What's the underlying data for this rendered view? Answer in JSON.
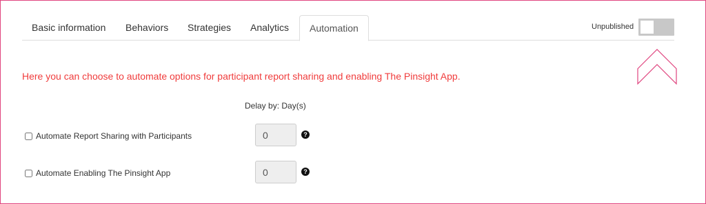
{
  "tabs": [
    {
      "label": "Basic information"
    },
    {
      "label": "Behaviors"
    },
    {
      "label": "Strategies"
    },
    {
      "label": "Analytics"
    },
    {
      "label": "Automation",
      "active": true
    }
  ],
  "publish": {
    "status_label": "Unpublished",
    "toggle_on": false
  },
  "intro_text": "Here you can choose to automate options for participant report sharing and enabling The Pinsight App.",
  "delay_label": "Delay by: Day(s)",
  "options": [
    {
      "label": "Automate Report Sharing with Participants",
      "checked": false,
      "delay_value": "0",
      "help_icon": "question-circle-icon"
    },
    {
      "label": "Automate Enabling The Pinsight App",
      "checked": false,
      "delay_value": "0",
      "help_icon": "question-circle-icon"
    }
  ],
  "colors": {
    "accent": "#e0447e",
    "intro_text": "#f03c3c",
    "toggle_track": "#c8c8c8"
  }
}
